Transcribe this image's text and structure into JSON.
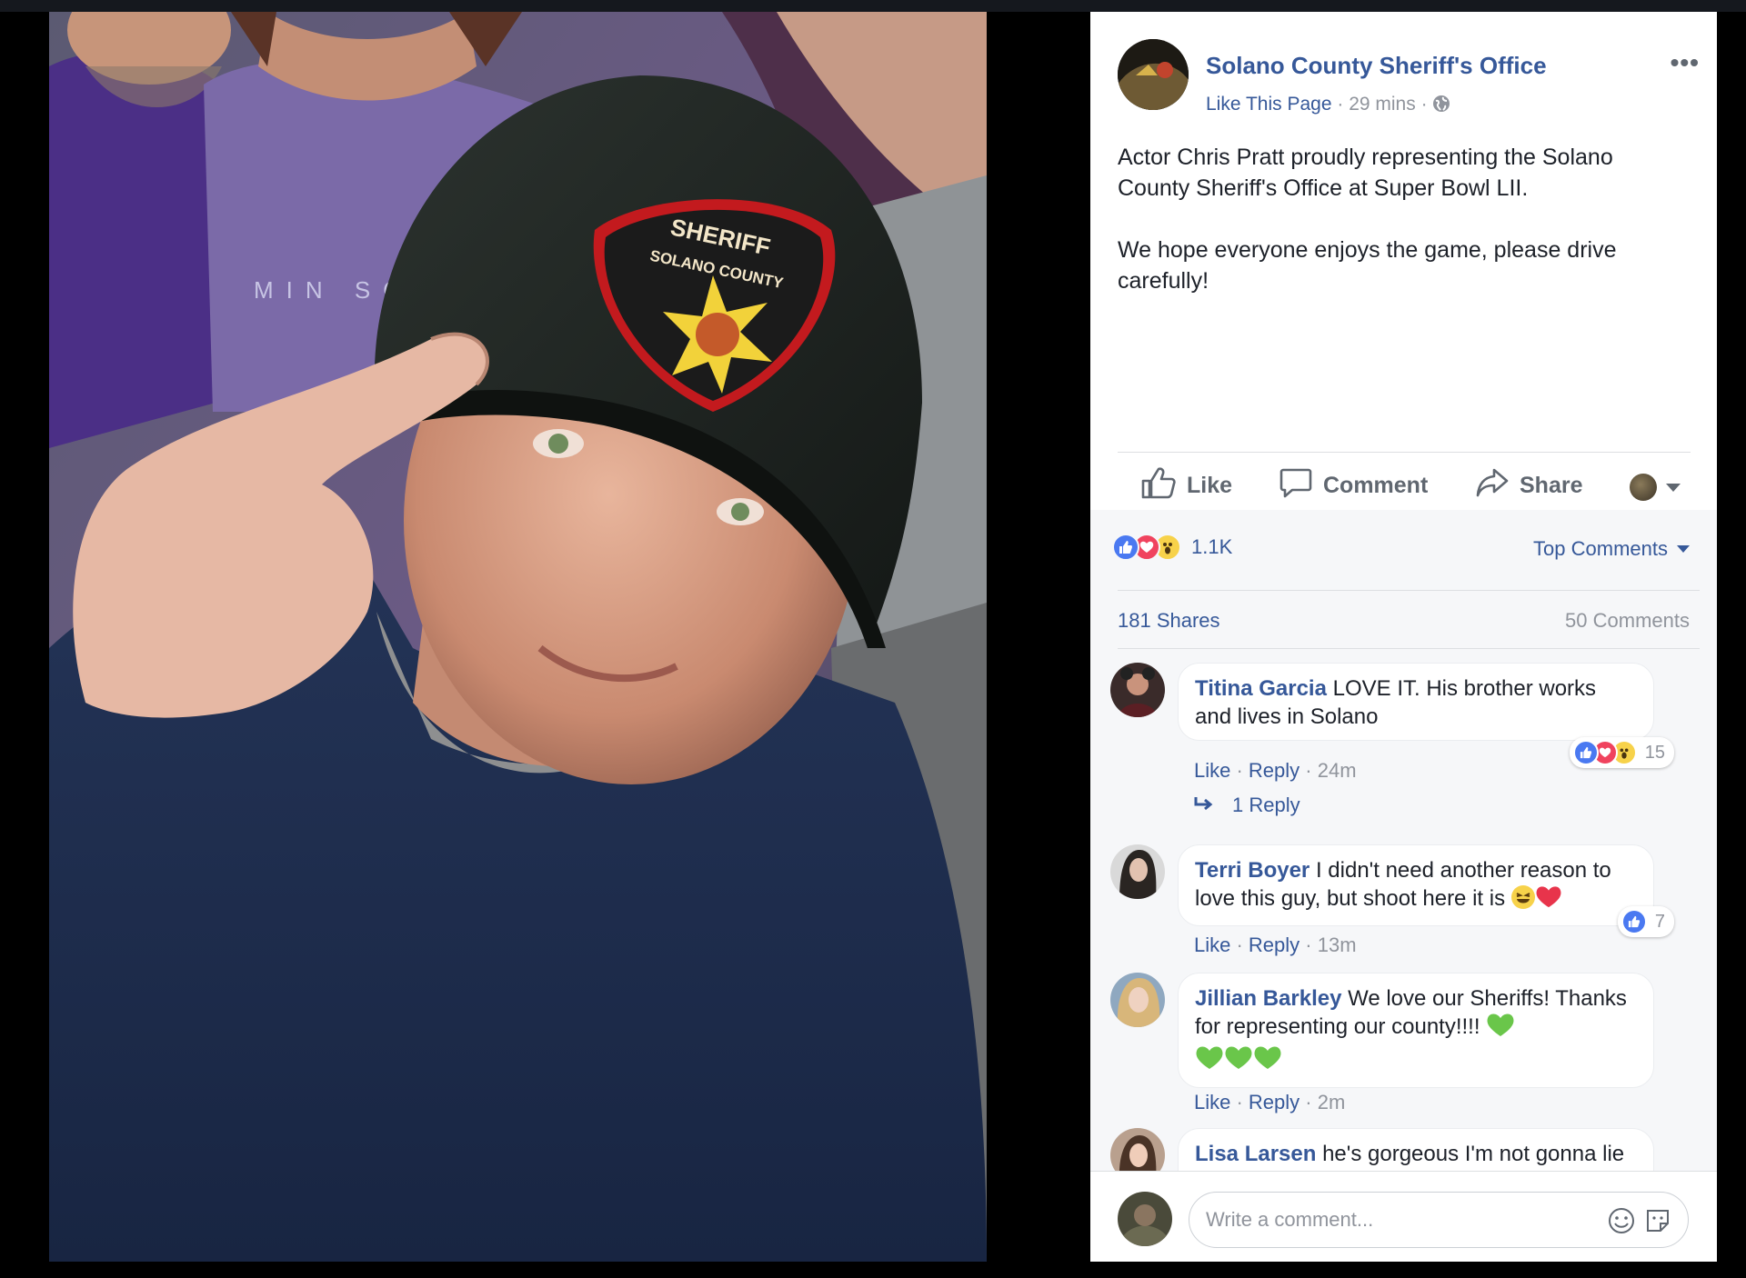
{
  "post": {
    "page_name": "Solano County Sheriff's Office",
    "like_page": "Like This Page",
    "meta_sep": " · ",
    "time": "29 mins",
    "text_p1": "Actor Chris Pratt proudly representing the Solano County Sheriff's Office at Super Bowl LII.",
    "text_p2": "We hope everyone enjoys the game, please drive carefully!",
    "more_label": "•••"
  },
  "actions": {
    "like": "Like",
    "comment": "Comment",
    "share": "Share"
  },
  "stats": {
    "reactions_count": "1.1K",
    "top_comments": "Top Comments",
    "shares": "181 Shares",
    "comments": "50 Comments"
  },
  "photo": {
    "badge_top": "SHERIFF",
    "badge_bottom": "SOLANO COUNTY",
    "shirt_text": "MIN  SOT"
  },
  "comments": [
    {
      "author": "Titina Garcia",
      "text": " LOVE IT. His brother works and lives in Solano",
      "like": "Like",
      "reply": "Reply",
      "time": "24m",
      "reactions": "15",
      "replies": "1 Reply"
    },
    {
      "author": "Terri Boyer",
      "text": " I didn't need another reason to love this guy, but shoot here it is ",
      "like": "Like",
      "reply": "Reply",
      "time": "13m",
      "reactions": "7"
    },
    {
      "author": "Jillian Barkley",
      "text": " We love our Sheriffs! Thanks for representing our county!!!! ",
      "like": "Like",
      "reply": "Reply",
      "time": "2m"
    },
    {
      "author": "Lisa Larsen",
      "text": " he's gorgeous I'm not gonna lie"
    }
  ],
  "composer": {
    "placeholder": "Write a comment..."
  },
  "colors": {
    "link": "#365899",
    "muted": "#90949c",
    "like_blue": "#4a79f1",
    "love_red": "#f0435e",
    "wow_yellow": "#f7d24a"
  },
  "icons": [
    "globe-icon",
    "more-icon",
    "thumbs-up-icon",
    "comment-icon",
    "share-arrow-icon",
    "caret-down-icon",
    "reply-arrow-icon",
    "smiley-icon",
    "sticker-icon"
  ]
}
